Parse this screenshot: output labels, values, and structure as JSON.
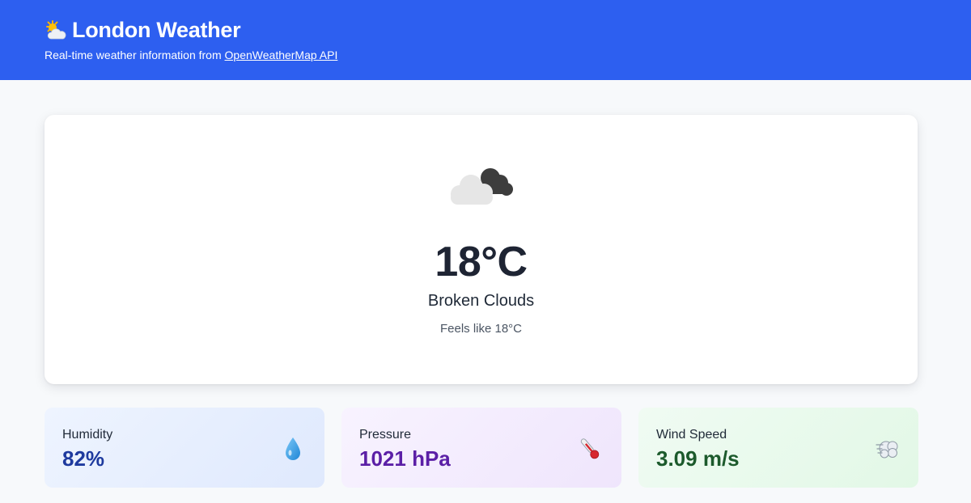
{
  "header": {
    "title": "London Weather",
    "subtitle_prefix": "Real-time weather information from ",
    "subtitle_link": "OpenWeatherMap API",
    "title_icon": "sun-behind-cloud-icon",
    "background": "#2d5ff0"
  },
  "current": {
    "icon": "broken-clouds-icon",
    "temperature": "18°C",
    "description": "Broken Clouds",
    "feels_like": "Feels like 18°C"
  },
  "stats": [
    {
      "label": "Humidity",
      "value": "82%",
      "icon": "droplet-icon",
      "value_color": "#1e3a9e"
    },
    {
      "label": "Pressure",
      "value": "1021 hPa",
      "icon": "thermometer-icon",
      "value_color": "#5b1fa6"
    },
    {
      "label": "Wind Speed",
      "value": "3.09 m/s",
      "icon": "wind-icon",
      "value_color": "#1c5a2c"
    }
  ]
}
